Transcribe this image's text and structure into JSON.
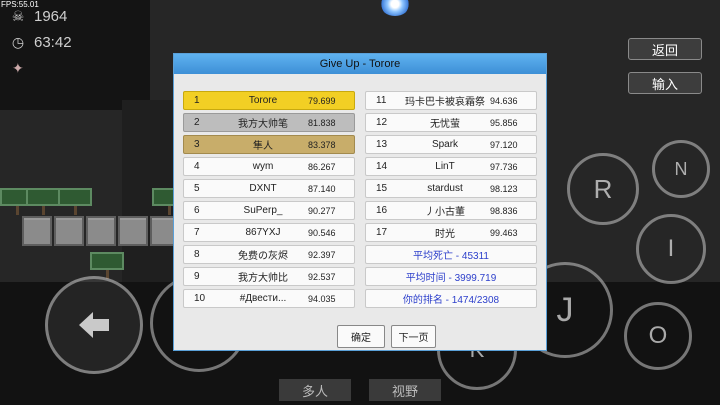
{
  "hud": {
    "fps": "FPS:55.01",
    "deaths_icon": "skull-icon",
    "deaths": "1964",
    "time_icon": "clock-icon",
    "time": "63:42"
  },
  "side_buttons": {
    "back": "返回",
    "input": "输入"
  },
  "bottom_buttons": {
    "multiplayer": "多人",
    "view": "视野"
  },
  "controls": {
    "r": "R",
    "n": "N",
    "i": "I",
    "j": "J",
    "k": "K",
    "o": "O",
    "left_icon": "arrow-left-icon",
    "right_icon": "arrow-right-icon"
  },
  "dialog": {
    "title": "Give Up - Torore",
    "left_rows": [
      {
        "rank": "1",
        "name": "Torore",
        "time": "79.699"
      },
      {
        "rank": "2",
        "name": "我方大帅笔",
        "time": "81.838"
      },
      {
        "rank": "3",
        "name": "隼人",
        "time": "83.378"
      },
      {
        "rank": "4",
        "name": "wym",
        "time": "86.267"
      },
      {
        "rank": "5",
        "name": "DXNT",
        "time": "87.140"
      },
      {
        "rank": "6",
        "name": "SuPerp_",
        "time": "90.277"
      },
      {
        "rank": "7",
        "name": "867YXJ",
        "time": "90.546"
      },
      {
        "rank": "8",
        "name": "免费の灰烬",
        "time": "92.397"
      },
      {
        "rank": "9",
        "name": "我方大帅比",
        "time": "92.537"
      },
      {
        "rank": "10",
        "name": "#Двести...",
        "time": "94.035"
      }
    ],
    "right_rows": [
      {
        "rank": "11",
        "name": "玛卡巴卡被哀霜祭",
        "time": "94.636"
      },
      {
        "rank": "12",
        "name": "无忧萤",
        "time": "95.856"
      },
      {
        "rank": "13",
        "name": "Spark",
        "time": "97.120"
      },
      {
        "rank": "14",
        "name": "LinT",
        "time": "97.736"
      },
      {
        "rank": "15",
        "name": "stardust",
        "time": "98.123"
      },
      {
        "rank": "16",
        "name": "丿小古董",
        "time": "98.836"
      },
      {
        "rank": "17",
        "name": "时光",
        "time": "99.463"
      }
    ],
    "stats": {
      "avg_deaths": "平均死亡 - 45311",
      "avg_time": "平均时间 - 3999.719",
      "your_rank": "你的排名 - 1474/2308"
    },
    "confirm": "确定",
    "next": "下一页"
  }
}
